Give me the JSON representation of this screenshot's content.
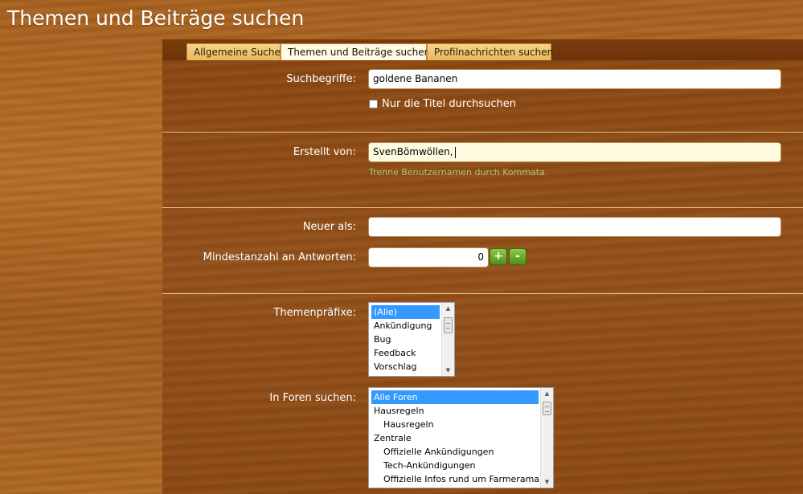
{
  "page": {
    "title": "Themen und Beiträge suchen"
  },
  "tabs": [
    {
      "label": "Allgemeine Suche",
      "active": false
    },
    {
      "label": "Themen und Beiträge suchen",
      "active": true
    },
    {
      "label": "Profilnachrichten suchen",
      "active": false
    }
  ],
  "form": {
    "keywords": {
      "label": "Suchbegriffe:",
      "value": "goldene Bananen"
    },
    "titles_only": {
      "label": "Nur die Titel durchsuchen",
      "checked": false
    },
    "author": {
      "label": "Erstellt von:",
      "value": "SvenBömwöllen,",
      "hint": "Trenne Benutzernamen durch Kommata."
    },
    "newer_than": {
      "label": "Neuer als:",
      "value": ""
    },
    "min_replies": {
      "label": "Mindestanzahl an Antworten:",
      "value": "0",
      "plus": "+",
      "minus": "-"
    },
    "prefixes": {
      "label": "Themenpräfixe:",
      "items": [
        "(Alle)",
        "Ankündigung",
        "Bug",
        "Feedback",
        "Vorschlag"
      ],
      "selected": "(Alle)"
    },
    "forums": {
      "label": "In Foren suchen:",
      "items": [
        {
          "label": "Alle Foren",
          "indent": false
        },
        {
          "label": "Hausregeln",
          "indent": false
        },
        {
          "label": "Hausregeln",
          "indent": true
        },
        {
          "label": "Zentrale",
          "indent": false
        },
        {
          "label": "Offizielle Ankündigungen",
          "indent": true
        },
        {
          "label": "Tech-Ankündigungen",
          "indent": true
        },
        {
          "label": "Offizielle Infos rund um Farmerama",
          "indent": true
        }
      ],
      "selected": "Alle Foren"
    }
  },
  "colors": {
    "tab_active": "#fff9e6",
    "tab": "#e8b85d",
    "hint": "#a9c96a",
    "divider": "#e9c27a",
    "stepper": "#4f8f18",
    "selection": "#3399ff"
  },
  "icons": {
    "scroll_up": "scroll-up-arrow-icon",
    "scroll_down": "scroll-down-arrow-icon",
    "checkbox": "checkbox-icon"
  }
}
